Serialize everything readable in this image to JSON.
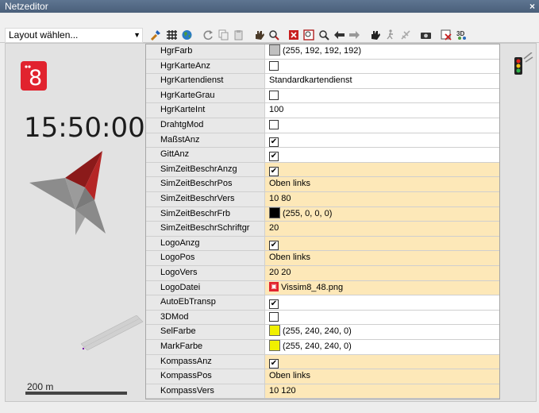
{
  "window": {
    "title": "Netzeditor",
    "close_label": "×"
  },
  "toolbar": {
    "layout_select": "Layout wählen...",
    "icons": [
      "wrench-icon",
      "tool-grid-icon",
      "globe-icon",
      "rotate-icon",
      "copy-icon",
      "clipboard-icon",
      "hand-drag-icon",
      "zoom-rect-icon",
      "zoom-fit-icon",
      "zoom-region-icon",
      "zoom-icon",
      "back-arrow-icon",
      "forward-arrow-icon",
      "pan-hand-icon",
      "walk-icon",
      "plane-icon",
      "camera-icon",
      "screenshot-icon",
      "3d-icon"
    ]
  },
  "canvas": {
    "logo_text": "8",
    "clock": "15:50:00",
    "scale_label": "200 m"
  },
  "grid": {
    "rows": [
      {
        "label": "HgrFarb",
        "type": "color",
        "swatch": "#c0c0c0",
        "value": "(255, 192, 192, 192)",
        "highlight": false
      },
      {
        "label": "HgrKarteAnz",
        "type": "check",
        "checked": false,
        "highlight": false
      },
      {
        "label": "HgrKartendienst",
        "type": "text",
        "value": "Standardkartendienst",
        "highlight": false
      },
      {
        "label": "HgrKarteGrau",
        "type": "check",
        "checked": false,
        "highlight": false
      },
      {
        "label": "HgrKarteInt",
        "type": "text",
        "value": "100",
        "highlight": false
      },
      {
        "label": "DrahtgMod",
        "type": "check",
        "checked": false,
        "highlight": false
      },
      {
        "label": "MaßstAnz",
        "type": "check",
        "checked": true,
        "highlight": false
      },
      {
        "label": "GittAnz",
        "type": "check",
        "checked": true,
        "highlight": false
      },
      {
        "label": "SimZeitBeschrAnzg",
        "type": "check",
        "checked": true,
        "highlight": true
      },
      {
        "label": "SimZeitBeschrPos",
        "type": "text",
        "value": "Oben links",
        "highlight": true
      },
      {
        "label": "SimZeitBeschrVers",
        "type": "text",
        "value": "10 80",
        "highlight": true
      },
      {
        "label": "SimZeitBeschrFrb",
        "type": "color",
        "swatch": "#000000",
        "value": "(255, 0, 0, 0)",
        "highlight": true
      },
      {
        "label": "SimZeitBeschrSchriftgr",
        "type": "text",
        "value": "20",
        "highlight": true
      },
      {
        "label": "LogoAnzg",
        "type": "check",
        "checked": true,
        "highlight": true
      },
      {
        "label": "LogoPos",
        "type": "text",
        "value": "Oben links",
        "highlight": true
      },
      {
        "label": "LogoVers",
        "type": "text",
        "value": "20 20",
        "highlight": true
      },
      {
        "label": "LogoDatei",
        "type": "file",
        "value": "Vissim8_48.png",
        "highlight": true
      },
      {
        "label": "AutoEbTransp",
        "type": "check",
        "checked": true,
        "highlight": false
      },
      {
        "label": "3DMod",
        "type": "check",
        "checked": false,
        "highlight": false
      },
      {
        "label": "SelFarbe",
        "type": "color",
        "swatch": "#f0f000",
        "value": "(255, 240, 240, 0)",
        "highlight": false
      },
      {
        "label": "MarkFarbe",
        "type": "color",
        "swatch": "#f0f000",
        "value": "(255, 240, 240, 0)",
        "highlight": false
      },
      {
        "label": "KompassAnz",
        "type": "check",
        "checked": true,
        "highlight": true
      },
      {
        "label": "KompassPos",
        "type": "text",
        "value": "Oben links",
        "highlight": true
      },
      {
        "label": "KompassVers",
        "type": "text",
        "value": "10 120",
        "highlight": true
      }
    ]
  }
}
